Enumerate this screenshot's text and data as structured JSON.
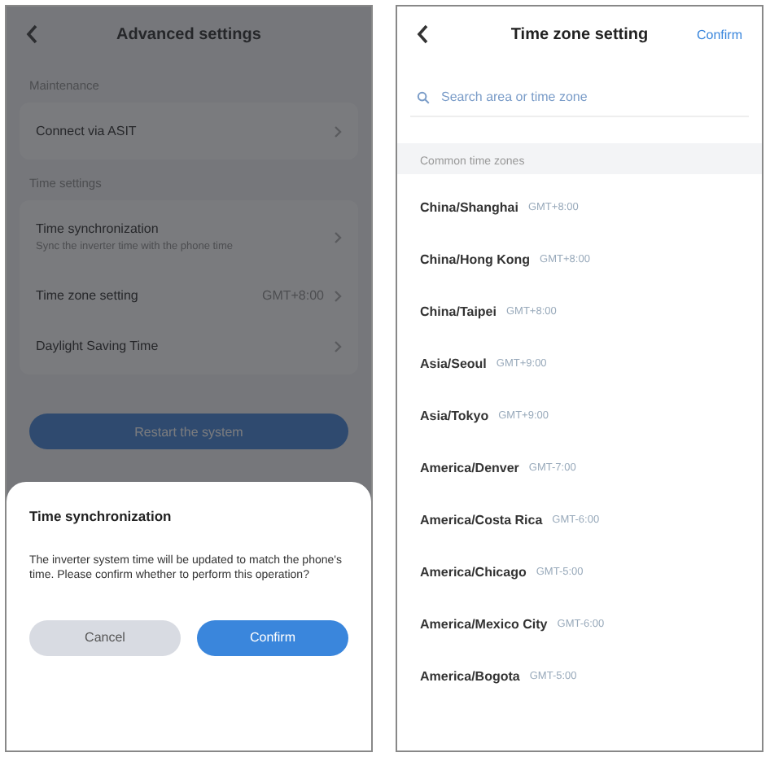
{
  "advanced_settings": {
    "title": "Advanced settings",
    "sections": [
      {
        "label": "Maintenance",
        "items": [
          {
            "label": "Connect via ASIT"
          }
        ]
      },
      {
        "label": "Time settings",
        "items": [
          {
            "label": "Time synchronization",
            "subtitle": "Sync the inverter time with the phone time"
          },
          {
            "label": "Time zone setting",
            "value": "GMT+8:00"
          },
          {
            "label": "Daylight Saving Time"
          }
        ]
      }
    ],
    "action_button": "Restart the system",
    "dialog": {
      "title": "Time synchronization",
      "message": "The inverter system time will be updated to match the phone's time. Please confirm whether to perform this operation?",
      "buttons": [
        {
          "label": "Cancel",
          "kind": "secondary"
        },
        {
          "label": "Confirm",
          "kind": "primary"
        }
      ]
    }
  },
  "time_zone_setting": {
    "title": "Time zone setting",
    "confirm": "Confirm",
    "search": {
      "placeholder": "Search area or time zone"
    },
    "section_label": "Common time zones",
    "zones": [
      {
        "name": "China/Shanghai",
        "offset": "GMT+8:00"
      },
      {
        "name": "China/Hong Kong",
        "offset": "GMT+8:00"
      },
      {
        "name": "China/Taipei",
        "offset": "GMT+8:00"
      },
      {
        "name": "Asia/Seoul",
        "offset": "GMT+9:00"
      },
      {
        "name": "Asia/Tokyo",
        "offset": "GMT+9:00"
      },
      {
        "name": "America/Denver",
        "offset": "GMT-7:00"
      },
      {
        "name": "America/Costa Rica",
        "offset": "GMT-6:00"
      },
      {
        "name": "America/Chicago",
        "offset": "GMT-5:00"
      },
      {
        "name": "America/Mexico City",
        "offset": "GMT-6:00"
      },
      {
        "name": "America/Bogota",
        "offset": "GMT-5:00"
      }
    ]
  }
}
